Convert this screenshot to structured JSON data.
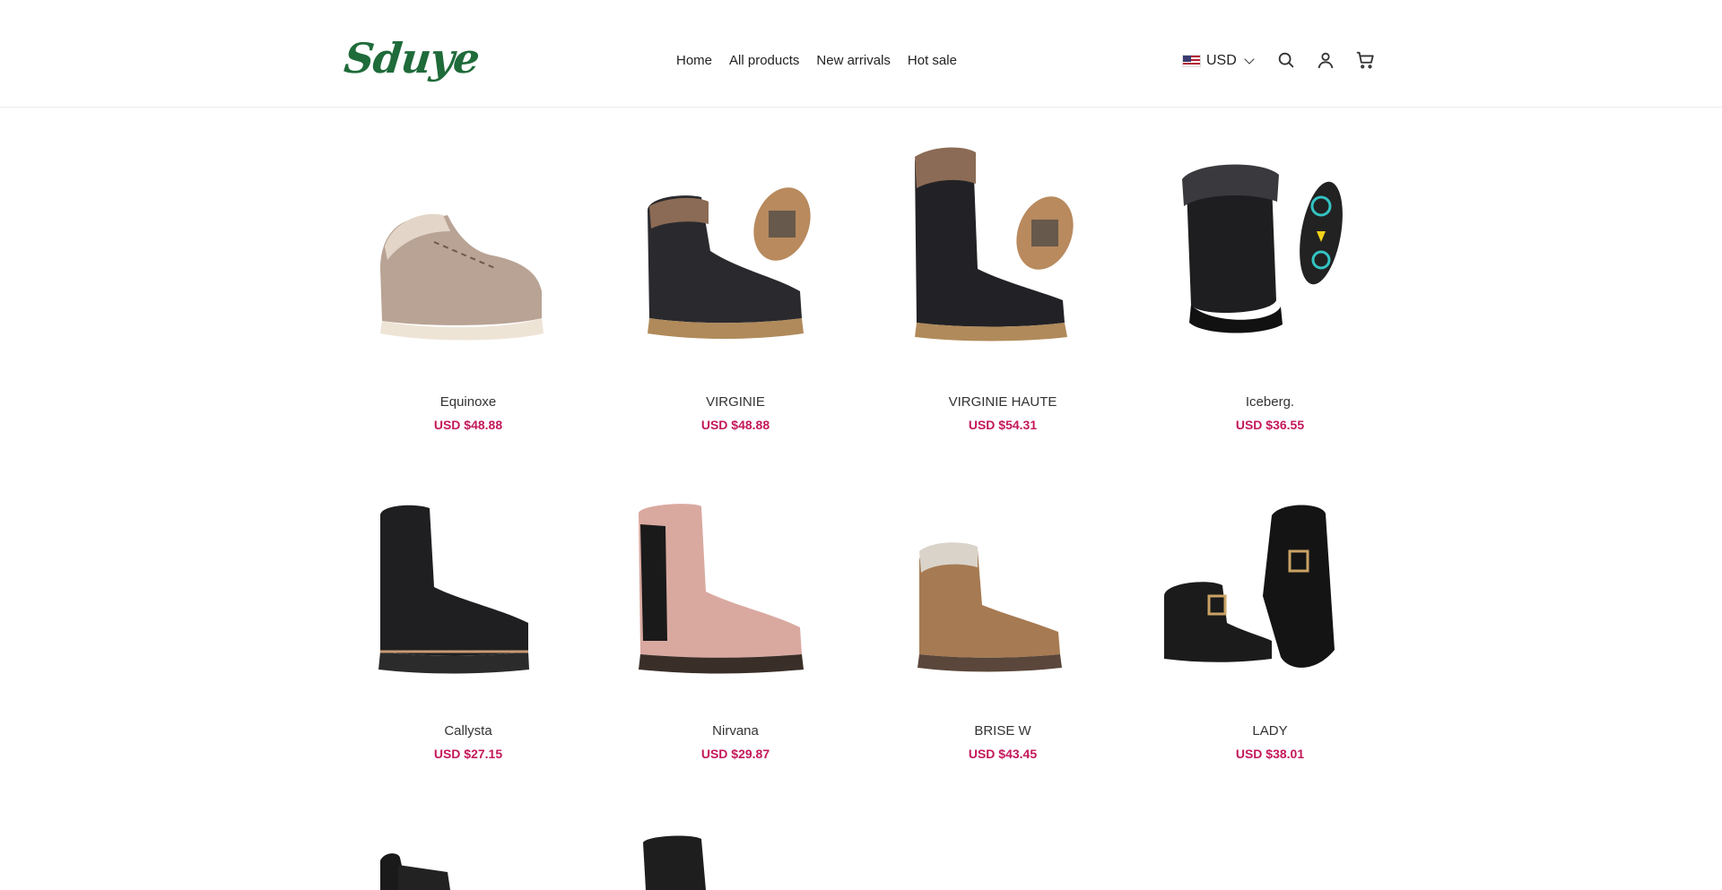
{
  "brand": {
    "logo_text": "Sduye",
    "accent": "#1f6b3a",
    "price_color": "#c4185a"
  },
  "nav": {
    "items": [
      "Home",
      "All products",
      "New arrivals",
      "Hot sale"
    ]
  },
  "currency": {
    "code": "USD",
    "flag_icon": "us-flag-icon"
  },
  "header_icons": [
    "search-icon",
    "account-icon",
    "cart-icon"
  ],
  "products": [
    {
      "name": "Equinoxe",
      "price": "USD $48.88"
    },
    {
      "name": "VIRGINIE",
      "price": "USD $48.88"
    },
    {
      "name": "VIRGINIE HAUTE",
      "price": "USD $54.31"
    },
    {
      "name": "Iceberg.",
      "price": "USD $36.55"
    },
    {
      "name": "Callysta",
      "price": "USD $27.15"
    },
    {
      "name": "Nirvana",
      "price": "USD $29.87"
    },
    {
      "name": "BRISE W",
      "price": "USD $43.45"
    },
    {
      "name": "LADY",
      "price": "USD $38.01"
    }
  ]
}
